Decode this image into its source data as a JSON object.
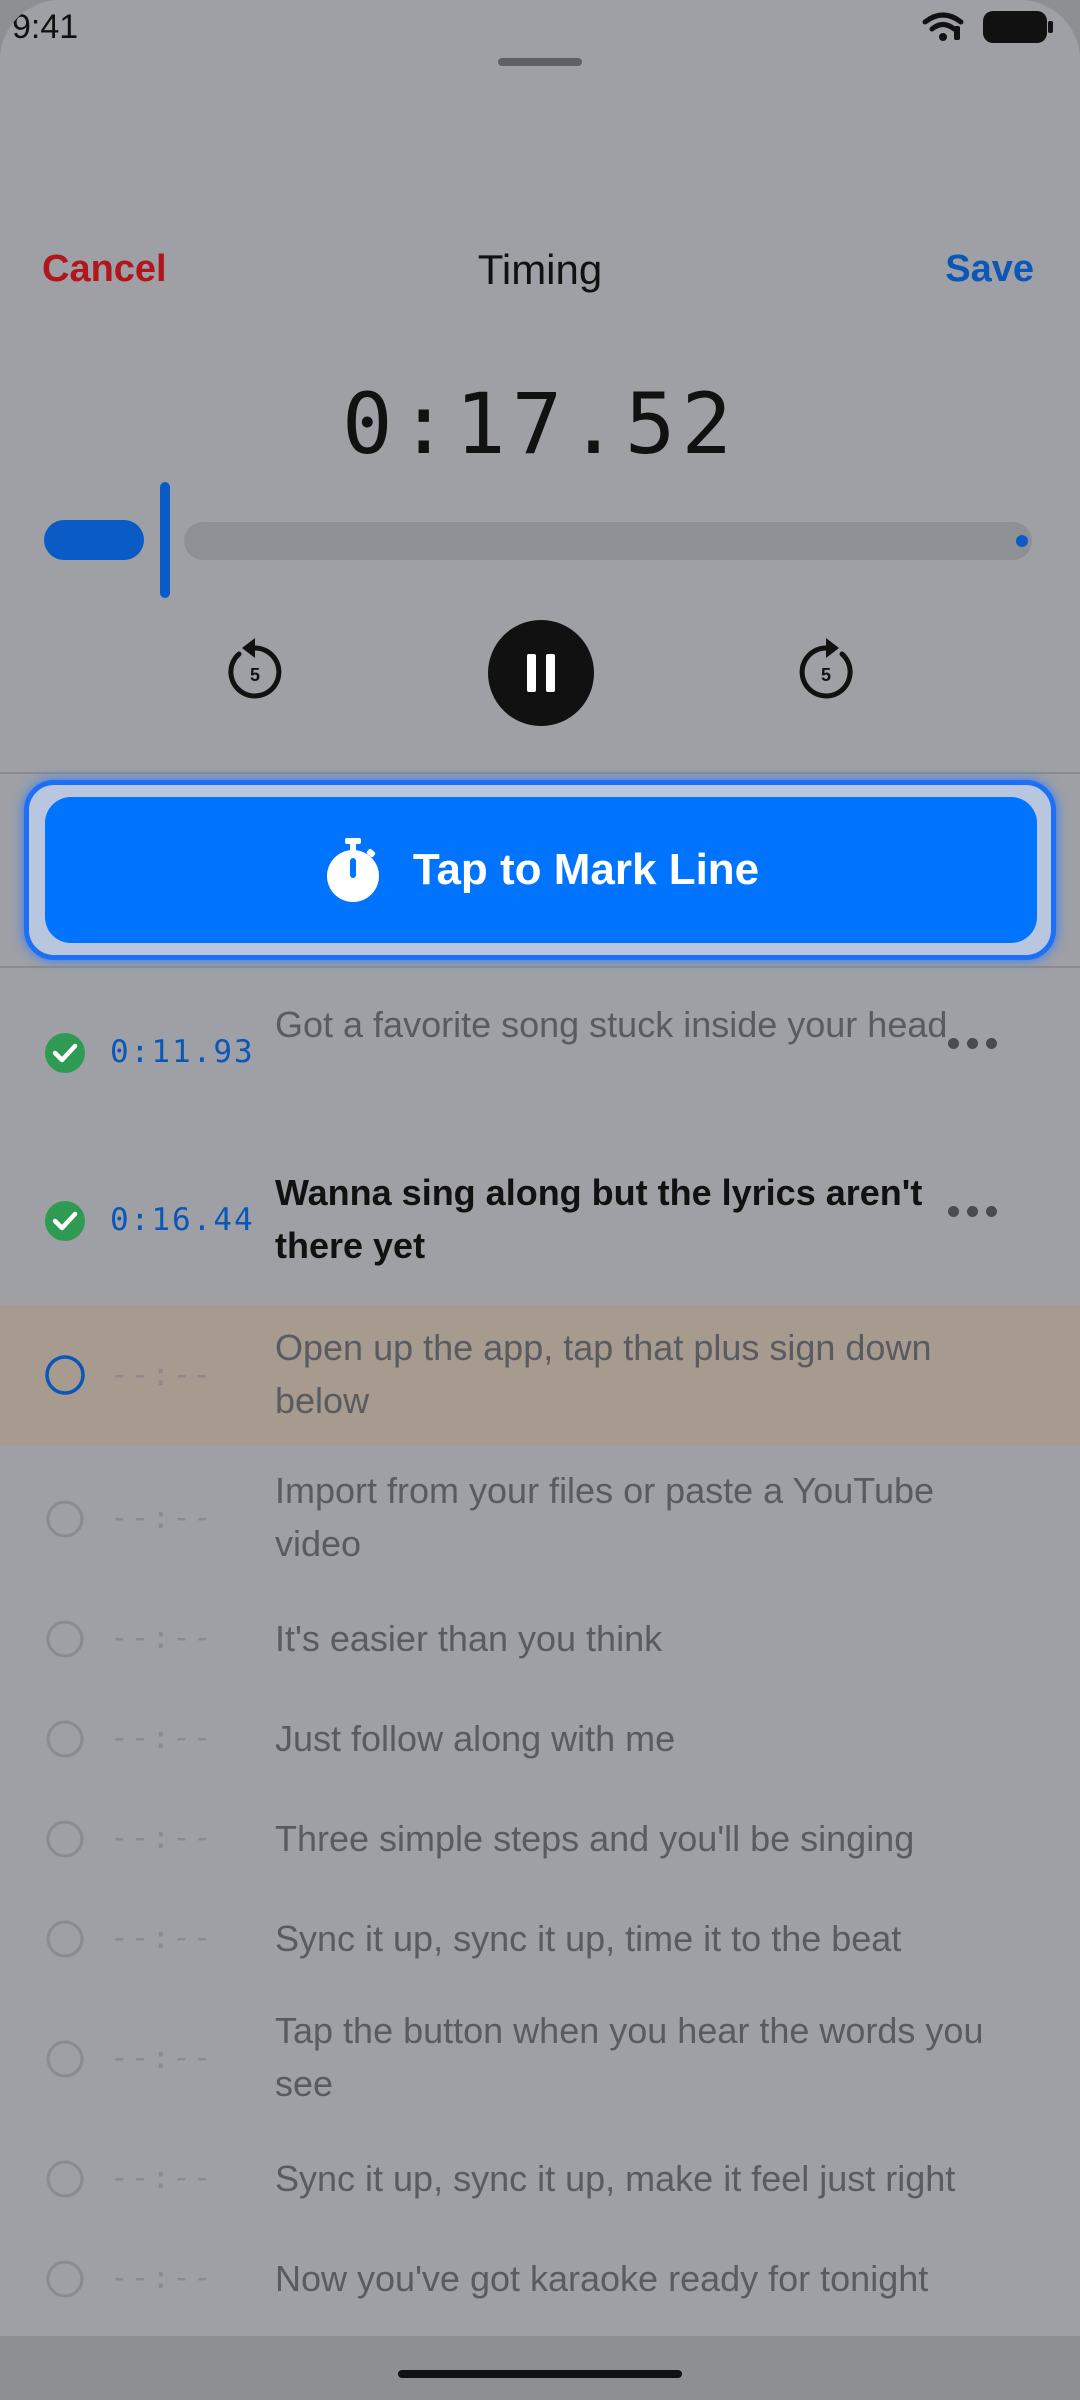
{
  "status_bar": {
    "time": "9:41"
  },
  "nav": {
    "cancel": "Cancel",
    "title": "Timing",
    "save": "Save"
  },
  "player": {
    "elapsed": "0:17.52",
    "skip_back_seconds": "5",
    "skip_forward_seconds": "5",
    "progress_fraction": 0.12
  },
  "mark_button": {
    "label": "Tap to Mark Line",
    "icon": "stopwatch-icon"
  },
  "lines": [
    {
      "state": "done",
      "time": "0:11.93",
      "text": "Got a favorite song stuck inside your head"
    },
    {
      "state": "done",
      "time": "0:16.44",
      "text": "Wanna sing along but the lyrics aren't there yet"
    },
    {
      "state": "current",
      "time": "--:--",
      "text": "Open up the app, tap that plus sign down below"
    },
    {
      "state": "pending",
      "time": "--:--",
      "text": "Import from your files or paste a YouTube video"
    },
    {
      "state": "pending",
      "time": "--:--",
      "text": "It's easier than you think"
    },
    {
      "state": "pending",
      "time": "--:--",
      "text": "Just follow along with me"
    },
    {
      "state": "pending",
      "time": "--:--",
      "text": "Three simple steps and you'll be singing"
    },
    {
      "state": "pending",
      "time": "--:--",
      "text": "Sync it up, sync it up, time it to the beat"
    },
    {
      "state": "pending",
      "time": "--:--",
      "text": "Tap the button when you hear the words you see"
    },
    {
      "state": "pending",
      "time": "--:--",
      "text": "Sync it up, sync it up, make it feel just right"
    },
    {
      "state": "pending",
      "time": "--:--",
      "text": "Now you've got karaoke ready for tonight"
    }
  ],
  "colors": {
    "accent": "#0073ff",
    "cancel": "#b0161b",
    "done": "#2f9a52",
    "current_row": "#a79a8e"
  }
}
